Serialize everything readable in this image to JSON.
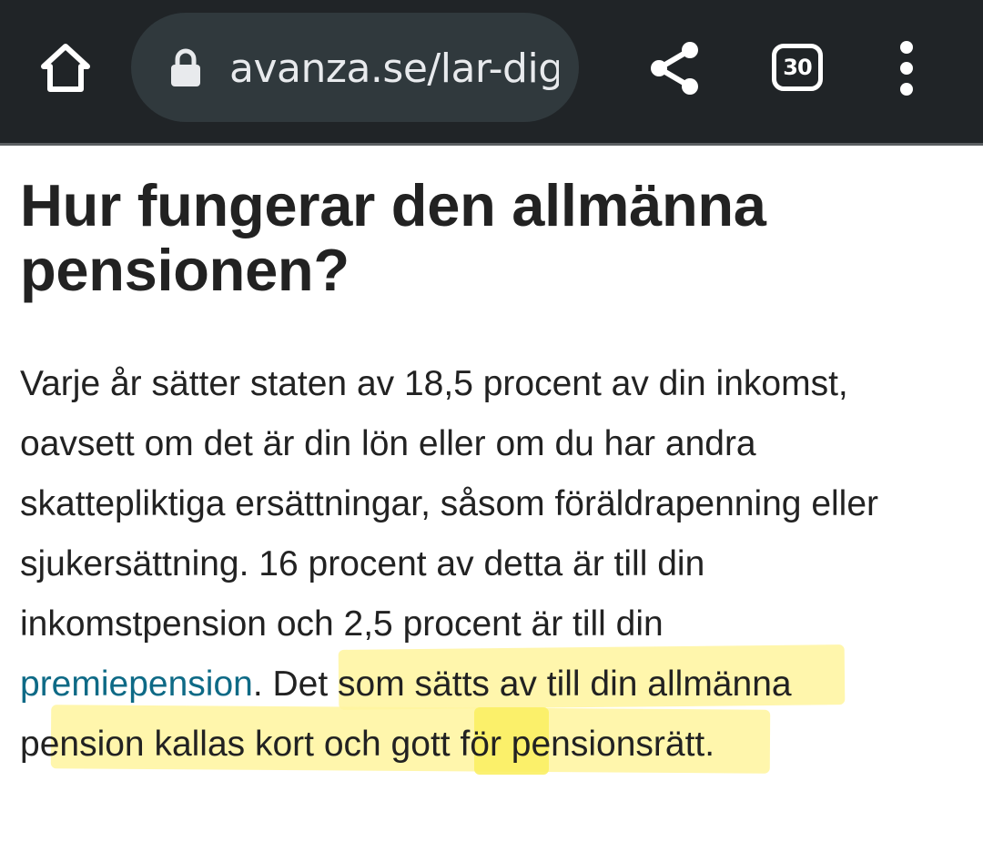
{
  "browser": {
    "url": "avanza.se/lar-dig",
    "tab_count": "30",
    "icons": {
      "home": "home-icon",
      "lock": "lock-icon",
      "share": "share-icon",
      "tabs": "tab-switcher-icon",
      "menu": "more-vertical-icon"
    },
    "colors": {
      "toolbar": "#202427",
      "omnibox": "#30393d"
    }
  },
  "article": {
    "title_line_1": "Hur fungerar den allmänna",
    "title_line_2": "pensionen?",
    "lines": [
      "Varje år sätter staten av 18,5 procent av din inkomst,",
      "oavsett om det är din lön eller om du har andra",
      "skattepliktiga ersättningar, såsom föräldrapenning eller",
      "sjukersättning. 16 procent av detta är till din",
      "inkomstpension och 2,5 procent är till din"
    ],
    "link_text": "premiepension",
    "line6_rest": ". Det som sätts av till din allmänna",
    "line7": "pension kallas kort och gott för pensionsrätt.",
    "colors": {
      "text": "#222222",
      "link": "#0e6a86",
      "highlight": "#fff59d"
    }
  }
}
